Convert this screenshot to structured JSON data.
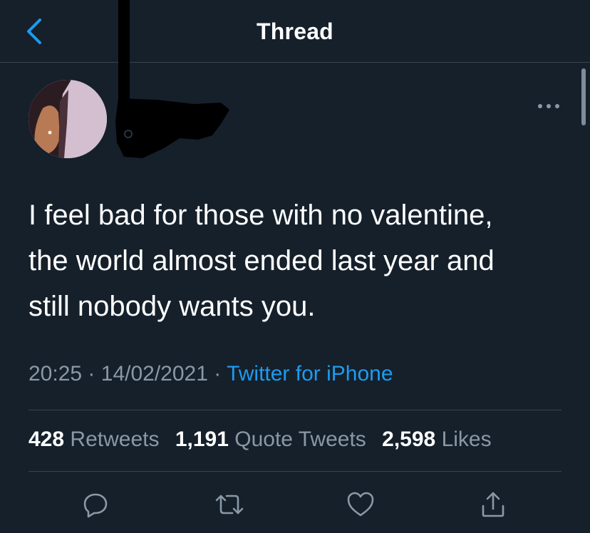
{
  "header": {
    "title": "Thread"
  },
  "tweet": {
    "text": "I feel bad for those with no valentine,\nthe world almost ended last year and\nstill nobody wants you.",
    "time": "20:25",
    "date": "14/02/2021",
    "source": "Twitter for iPhone",
    "separator": "·"
  },
  "stats": {
    "retweets_count": "428",
    "retweets_label": "Retweets",
    "quotes_count": "1,191",
    "quotes_label": "Quote Tweets",
    "likes_count": "2,598",
    "likes_label": "Likes"
  },
  "actions": {
    "reply_icon": "reply-icon",
    "retweet_icon": "retweet-icon",
    "like_icon": "heart-icon",
    "share_icon": "share-icon"
  },
  "colors": {
    "background": "#15202b",
    "accent": "#1d9bf0",
    "secondary_text": "#8b98a5",
    "divider": "#38444d"
  }
}
